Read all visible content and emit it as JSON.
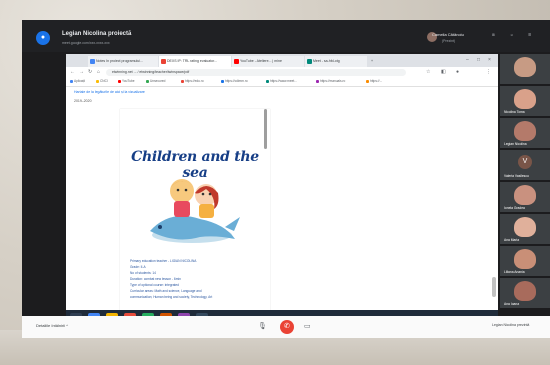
{
  "meet": {
    "title": "Legian Nicolina proiectă",
    "url": "meet.google.com/xxx-xxxx-xxx",
    "presenter_name": "Camelia Cătănoiu",
    "presenter_sub": "(Prezint)",
    "controls": [
      "⊞",
      "☺",
      "☰"
    ],
    "meeting_details_label": "Detaliile întâlnirii  ^",
    "present_label": "Legian Nicolina prezintă"
  },
  "browser": {
    "tabs": [
      {
        "label": "Notes în proiect programului...",
        "color": "#4285f4",
        "active": false
      },
      {
        "label": "DEXS IP: TRL rating evaluator...",
        "color": "#ea4335",
        "active": true
      },
      {
        "label": "YouTube - Ateliere... | mine",
        "color": "#ff0000",
        "active": false
      },
      {
        "label": "Meet - sa-hfd-otg",
        "color": "#00897b",
        "active": false
      },
      {
        "label": "+",
        "color": "#dee1e6",
        "active": false
      }
    ],
    "url": "etwinning.net ... / etwinning/teacher/twinspace/pdf",
    "bookmarks": [
      "Aplicații",
      "CNCI",
      "YouTube",
      "Unsecured",
      "https://edu.ro",
      "https://cdimm.ro",
      "https://www.meet...",
      "https://manuals.ro",
      "https://..."
    ]
  },
  "page": {
    "top_link": "Hartale de la legăturile de aici și la vizualizare",
    "date": "2019–2020",
    "doc_title": "Children and the sea",
    "doc_lines": [
      "Primary education teacher - LIGIAN NICOLINA",
      "Grade: II-A",
      "No of students: 14",
      "Duration: combat new lesson - 6min",
      "Type of optional course: integrated",
      "Curricular areas: Math and science, Language and",
      "communication; Human being and society, Technology, Art"
    ],
    "pdf_pages": "1 of 5",
    "bottom_link": "Capture și realizare: 3D carte/illustrations"
  },
  "participants": [
    {
      "name": "",
      "kind": "face",
      "color": "#c79b84"
    },
    {
      "name": "Nicolina Toma",
      "kind": "face",
      "color": "#d9a18a"
    },
    {
      "name": "Legian Nicolina",
      "kind": "face",
      "color": "#b47a6a"
    },
    {
      "name": "Valeria Vasilescu",
      "kind": "avatar",
      "letter": "V"
    },
    {
      "name": "Ionela Gradea",
      "kind": "face",
      "color": "#c9917f"
    },
    {
      "name": "Ana Maria",
      "kind": "face",
      "color": "#e0b09b"
    },
    {
      "name": "Liliana Anania",
      "kind": "face",
      "color": "#c98f77"
    },
    {
      "name": "Ana Ioana",
      "kind": "face",
      "color": "#a86b5c"
    }
  ],
  "colors": {
    "meet_dark": "#202124",
    "hangup": "#ea4335",
    "link": "#1a73e8",
    "doc_title": "#163e86"
  },
  "icons": [
    "meet-logo-icon",
    "back-icon",
    "forward-icon",
    "reload-icon",
    "home-icon",
    "close-icon",
    "hangup-icon",
    "mic-icon",
    "camera-icon"
  ]
}
